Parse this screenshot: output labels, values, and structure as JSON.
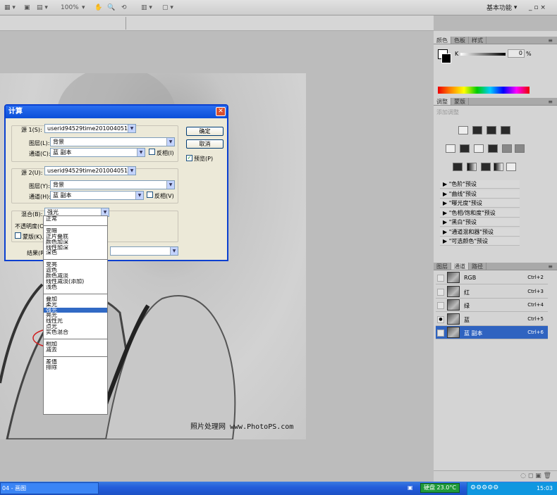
{
  "app": {
    "workspace": "基本功能",
    "zoom": "100%"
  },
  "watermark": "照片处理网 www.PhotoPS.com",
  "dialog": {
    "title": "计算",
    "source1": {
      "label": "源 1(S):",
      "doc": "userid94529time2010040510...",
      "layer_label": "图层(L):",
      "layer": "背景",
      "channel_label": "通道(C):",
      "channel": "蓝 副本",
      "invert": "反相(I)"
    },
    "source2": {
      "label": "源 2(U):",
      "doc": "userid94529time2010040510...",
      "layer_label": "图层(Y):",
      "layer": "背景",
      "channel_label": "通道(H):",
      "channel": "蓝 副本",
      "invert": "反相(V)"
    },
    "blend_label": "混合(B):",
    "blend_value": "强光",
    "opacity_label": "不透明度(O",
    "mask_label": "蒙版(K)...",
    "result_label": "结果(R",
    "ok": "确定",
    "cancel": "取消",
    "preview": "预览(P)"
  },
  "blend_modes": [
    [
      "正常"
    ],
    [
      "变暗",
      "正片叠底",
      "颜色加深",
      "线性加深",
      "深色"
    ],
    [
      "变亮",
      "滤色",
      "颜色减淡",
      "线性减淡(添加)",
      "浅色"
    ],
    [
      "叠加",
      "柔光",
      "强光",
      "亮光",
      "线性光",
      "点光",
      "实色混合"
    ],
    [
      "相加",
      "减去"
    ],
    [
      "差值",
      "排除"
    ]
  ],
  "selected_blend": "强光",
  "color_panel": {
    "tabs": [
      "颜色",
      "色板",
      "样式"
    ],
    "k_label": "K",
    "k_value": "0",
    "percent": "%"
  },
  "adjust_panel": {
    "tabs": [
      "调整",
      "蒙版"
    ],
    "subtitle": "添加调整",
    "presets": [
      "\"色阶\"预设",
      "\"曲线\"预设",
      "\"曝光度\"预设",
      "\"色相/饱和度\"预设",
      "\"黑白\"预设",
      "\"通道混和器\"预设",
      "\"可选颜色\"预设"
    ]
  },
  "channels_panel": {
    "tabs": [
      "图层",
      "通道",
      "路径"
    ],
    "rows": [
      {
        "name": "RGB",
        "shortcut": "Ctrl+2"
      },
      {
        "name": "红",
        "shortcut": "Ctrl+3"
      },
      {
        "name": "绿",
        "shortcut": "Ctrl+4"
      },
      {
        "name": "蓝",
        "shortcut": "Ctrl+5"
      },
      {
        "name": "蓝 副本",
        "shortcut": "Ctrl+6"
      }
    ]
  },
  "taskbar": {
    "left_text": "04 - 画图",
    "disk_text": "硬盘 23.0°C",
    "time": "15:03"
  },
  "colors": {
    "accent": "#316ac5",
    "title_blue": "#0b4fd8",
    "selection": "#2f63c0",
    "annot": "#d02020"
  }
}
